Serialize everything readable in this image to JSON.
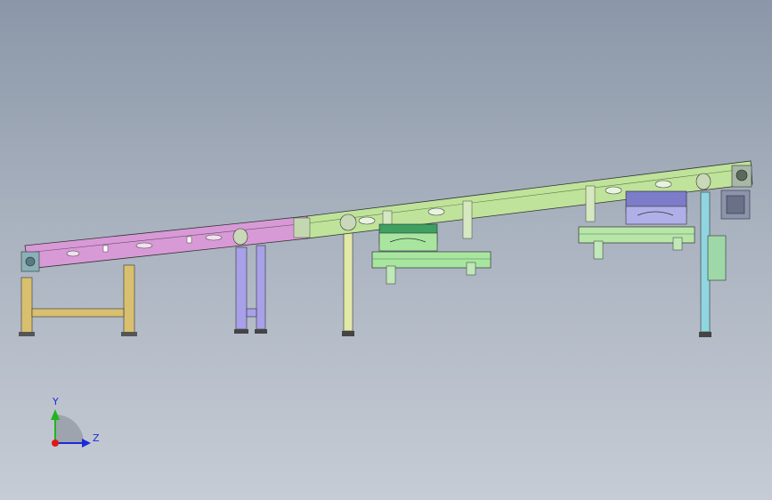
{
  "viewport": {
    "title": "",
    "background_top": "#8b97a8",
    "background_bottom": "#c6ccd5"
  },
  "model": {
    "name": "",
    "parts": [
      {
        "name": "frame-section-1",
        "color": "#d89ad6"
      },
      {
        "name": "frame-section-2",
        "color": "#bfe39a"
      },
      {
        "name": "support-leg-1",
        "color": "#d8c070"
      },
      {
        "name": "support-leg-2",
        "color": "#a8a0e8"
      },
      {
        "name": "support-leg-3",
        "color": "#e2e8a8"
      },
      {
        "name": "support-leg-4",
        "color": "#8fd6e0"
      },
      {
        "name": "carriage-1",
        "color": "#a8e6a0"
      },
      {
        "name": "carriage-2",
        "color": "#b8e6a8"
      },
      {
        "name": "drive-motor",
        "color": "#8a94ac"
      },
      {
        "name": "control-box",
        "color": "#9ed8a8"
      }
    ]
  },
  "triad": {
    "y_label": "Y",
    "z_label": "Z",
    "y_color": "#1fb51f",
    "z_color": "#1a2bd8",
    "origin_color": "#e01818"
  }
}
